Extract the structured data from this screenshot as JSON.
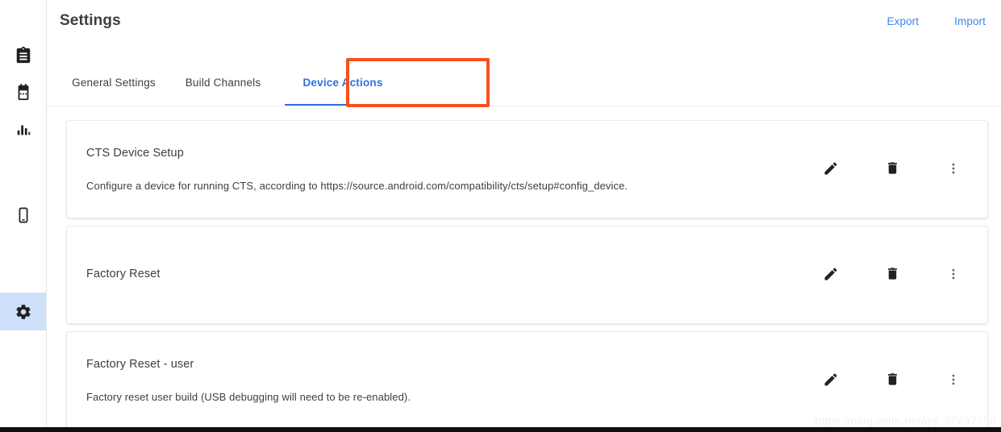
{
  "sidebar": {
    "items": [
      {
        "name": "clipboard-icon",
        "label": "Test Runs",
        "active": false
      },
      {
        "name": "calendar-icon",
        "label": "Test Plans",
        "active": false
      },
      {
        "name": "bar-chart-icon",
        "label": "Test Results",
        "active": false
      },
      {
        "name": "device-icon",
        "label": "Devices",
        "active": false
      },
      {
        "name": "gear-icon",
        "label": "Settings",
        "active": true
      }
    ],
    "active_highlight_color": "#cfe0fb"
  },
  "header": {
    "title": "Settings",
    "export_label": "Export",
    "import_label": "Import",
    "link_color": "#3f85f0"
  },
  "tabs": {
    "items": [
      {
        "label": "General Settings",
        "active": false
      },
      {
        "label": "Build Channels",
        "active": false
      },
      {
        "label": "Device Actions",
        "active": true
      }
    ],
    "active_color": "#2f6fe0",
    "annotation_color": "#f4511e"
  },
  "device_actions": [
    {
      "title": "CTS Device Setup",
      "description": "Configure a device for running CTS, according to https://source.android.com/compatibility/cts/setup#config_device.",
      "actions": [
        "edit-icon",
        "delete-icon",
        "more-vert-icon"
      ]
    },
    {
      "title": "Factory Reset",
      "description": "",
      "actions": [
        "edit-icon",
        "delete-icon",
        "more-vert-icon"
      ]
    },
    {
      "title": "Factory Reset - user",
      "description": "Factory reset user build (USB debugging will need to be re-enabled).",
      "actions": [
        "edit-icon",
        "delete-icon",
        "more-vert-icon"
      ]
    }
  ],
  "watermark": {
    "text": "https://blog.csdn.net/qq_37497758"
  }
}
